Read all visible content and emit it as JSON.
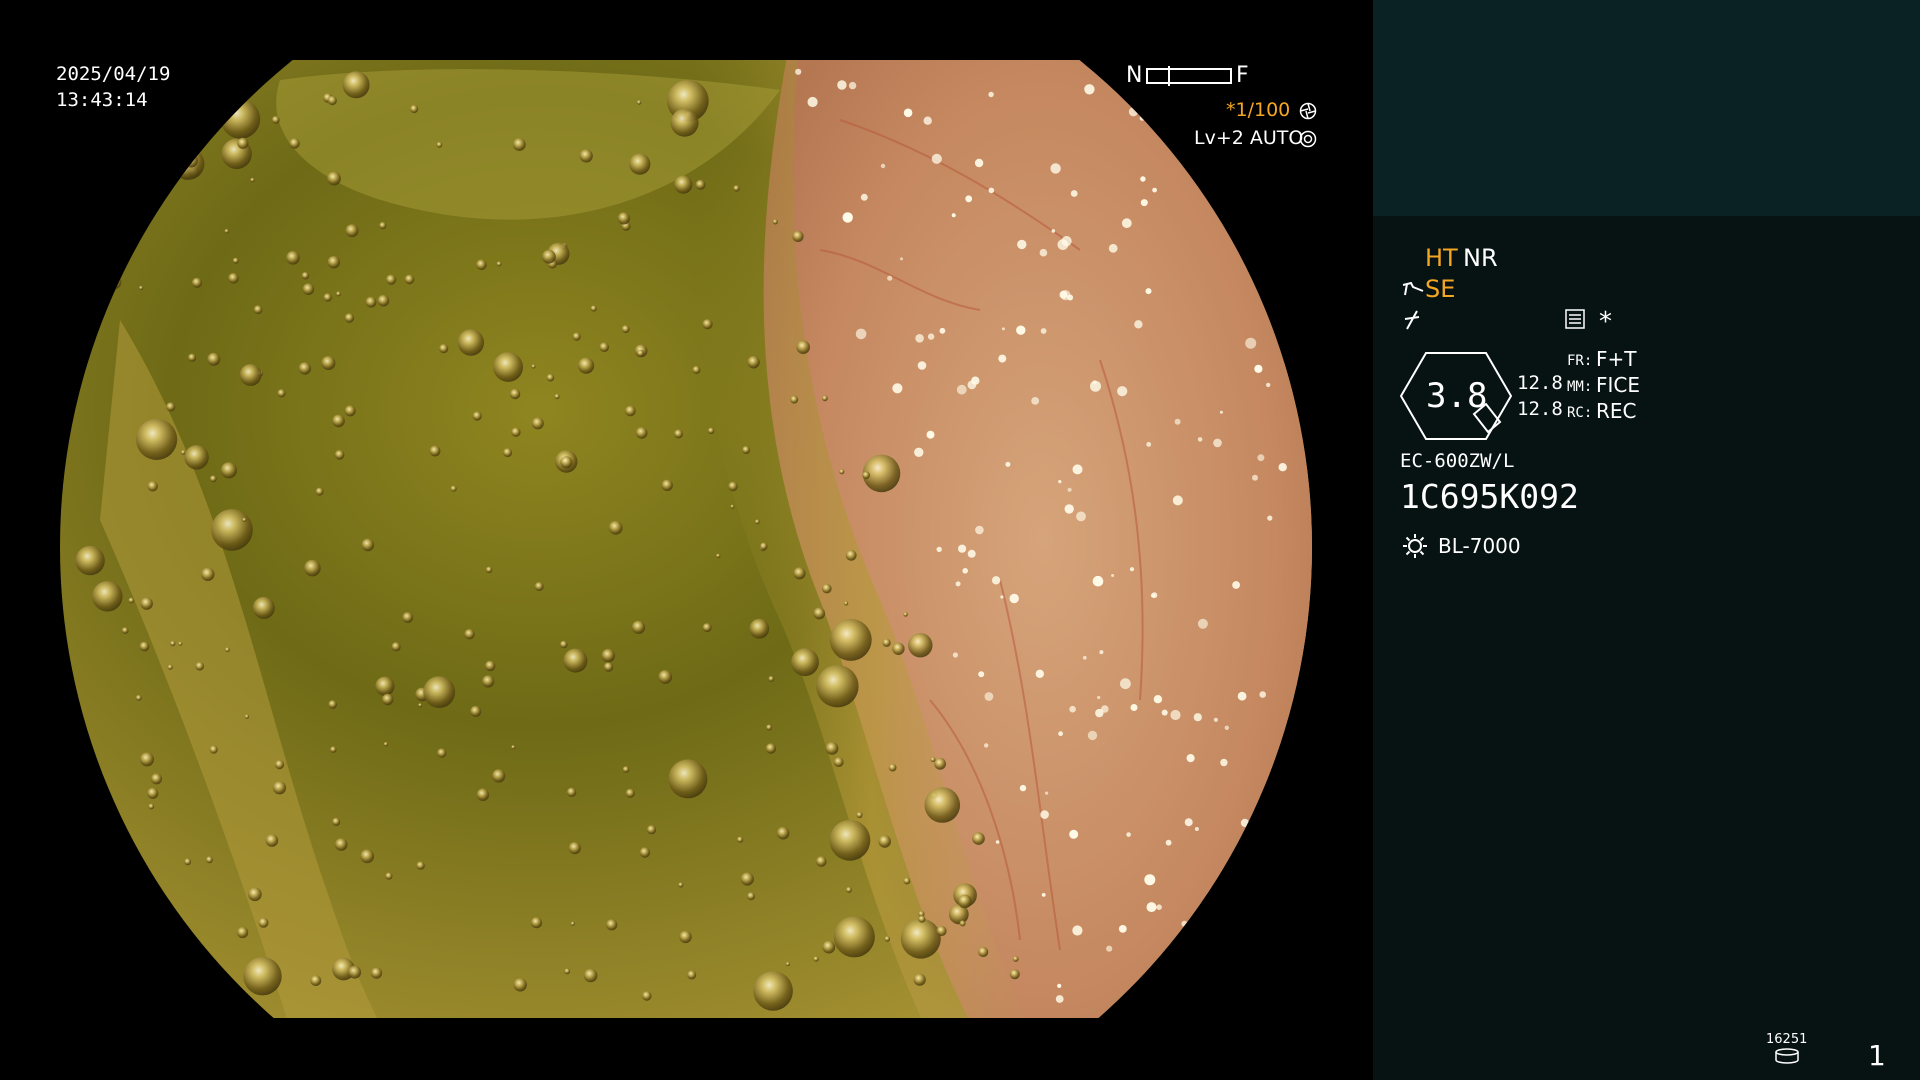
{
  "viewport": {
    "date": "2025/04/19",
    "time": "13:43:14",
    "focus_near": "N",
    "focus_far": "F",
    "shutter": "*1/100",
    "level": "Lv+2 AUTO",
    "icons": [
      "iris-icon",
      "auto-exposure-icon"
    ]
  },
  "side_panel": {
    "ht": "HT",
    "nr": "NR",
    "se": "SE",
    "asterisk": "*",
    "zoom": "3.8",
    "val1": "12.8",
    "val2": "12.8",
    "fr_label": "FR:",
    "fr_value": "F+T",
    "mm_label": "MM:",
    "mm_value": "FICE",
    "rc_label": "RC:",
    "rc_value": "REC",
    "scope_model": "EC-600ZW/L",
    "serial": "1C695K092",
    "light_source": "BL-7000",
    "storage_count": "16251",
    "page_number": "1",
    "accent_color": "#f5a623",
    "icons": [
      "scope-tip-icon",
      "flash-icon",
      "menu-icon",
      "lamp-icon",
      "storage-icon"
    ]
  }
}
